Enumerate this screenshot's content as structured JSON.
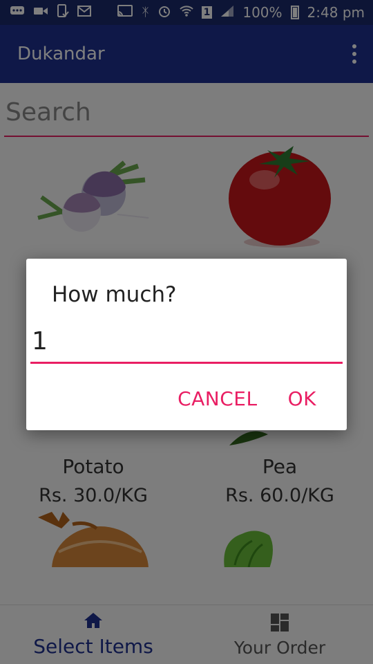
{
  "status_bar": {
    "battery": "100%",
    "time": "2:48 pm",
    "sim": "1"
  },
  "app_bar": {
    "title": "Dukandar"
  },
  "search": {
    "placeholder": "Search"
  },
  "products": [
    {
      "name": "Potato",
      "price": "Rs. 30.0/KG"
    },
    {
      "name": "Pea",
      "price": "Rs. 60.0/KG"
    }
  ],
  "bottom_nav": {
    "tabs": [
      {
        "label": "Select Items",
        "icon": "home-icon",
        "active": true
      },
      {
        "label": "Your Order",
        "icon": "dashboard-icon",
        "active": false
      }
    ]
  },
  "dialog": {
    "title": "How much?",
    "quantity": "1",
    "cancel_label": "CANCEL",
    "ok_label": "OK"
  },
  "colors": {
    "primary": "#1f3191",
    "status_bar": "#1a2a6c",
    "accent": "#e91e63"
  }
}
